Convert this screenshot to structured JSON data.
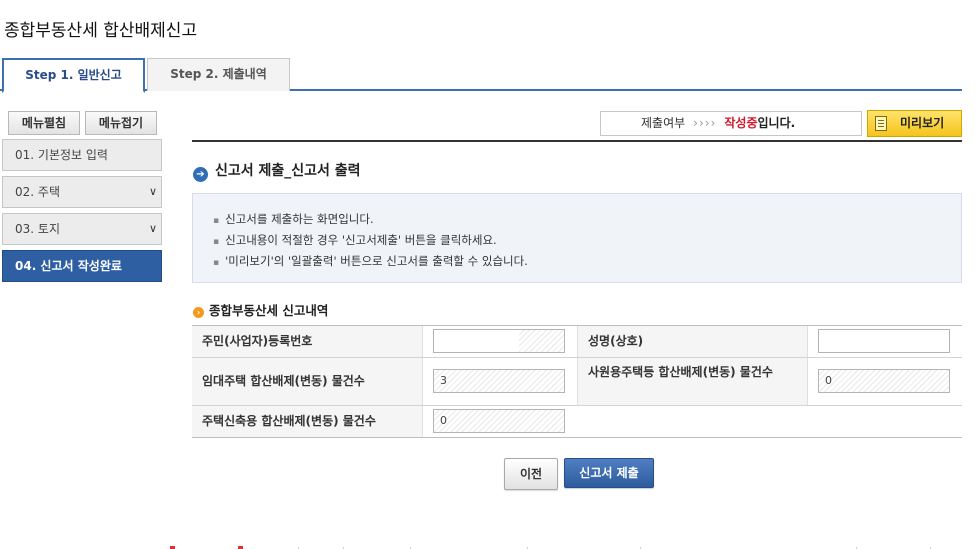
{
  "page": {
    "title": "종합부동산세 합산배제신고"
  },
  "tabs": [
    {
      "label": "Step 1. 일반신고",
      "active": true
    },
    {
      "label": "Step 2. 제출내역",
      "active": false
    }
  ],
  "sidebar": {
    "expand_label": "메뉴펼침",
    "collapse_label": "메뉴접기",
    "items": [
      {
        "label": "01. 기본정보 입력"
      },
      {
        "label": "02. 주택",
        "expandable": true
      },
      {
        "label": "03. 토지",
        "expandable": true
      },
      {
        "label": "04. 신고서 작성완료",
        "active": true
      }
    ]
  },
  "status": {
    "label": "제출여부",
    "arrows": "››››",
    "state": "작성중",
    "suffix": "입니다.",
    "state_color": "#d2182d"
  },
  "preview_button": {
    "label": "미리보기",
    "icon": "document-icon"
  },
  "section": {
    "title": "신고서 제출_신고서 출력",
    "icon": "arrow-circle-icon",
    "bullets": [
      "신고서를 제출하는 화면입니다.",
      "신고내용이 적절한 경우 '신고서제출' 버튼을 클릭하세요.",
      "'미리보기'의 '일괄출력' 버튼으로 신고서를 출력할 수 있습니다."
    ]
  },
  "summary": {
    "title": "종합부동산세 신고내역",
    "icon": "arrow-circle-icon",
    "fields": {
      "resident_id": {
        "label": "주민(사업자)등록번호",
        "value": ""
      },
      "name": {
        "label": "성명(상호)",
        "value": ""
      },
      "rental_count": {
        "label": "임대주택 합산배제(변동) 물건수",
        "value": "3"
      },
      "employee_count": {
        "label": "사원용주택등 합산배제(변동) 물건수",
        "value": "0"
      },
      "new_housing_count": {
        "label": "주택신축용 합산배제(변동) 물건수",
        "value": "0"
      }
    }
  },
  "actions": {
    "prev_label": "이전",
    "submit_label": "신고서 제출"
  },
  "colors": {
    "accent": "#2e5fa3",
    "highlight": "#f5c41d",
    "alert": "#d2182d"
  }
}
